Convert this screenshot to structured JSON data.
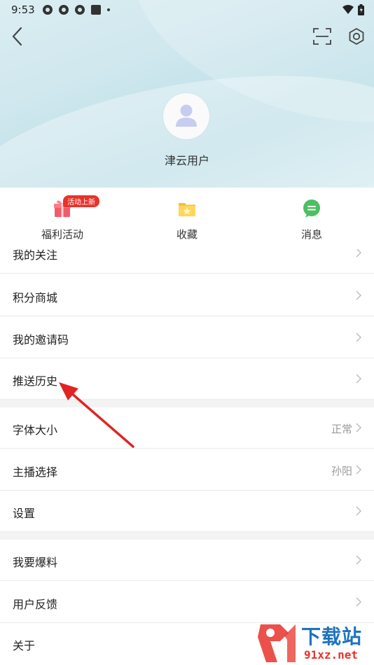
{
  "status_bar": {
    "time": "9:53"
  },
  "profile": {
    "username": "津云用户"
  },
  "quick_actions": [
    {
      "label": "福利活动",
      "badge": "活动上新",
      "icon": "gift-icon"
    },
    {
      "label": "收藏",
      "icon": "folder-star-icon"
    },
    {
      "label": "消息",
      "icon": "chat-bubble-icon"
    }
  ],
  "menu_group1": [
    {
      "label": "我的关注"
    },
    {
      "label": "积分商城"
    },
    {
      "label": "我的邀请码"
    },
    {
      "label": "推送历史"
    }
  ],
  "menu_group2": [
    {
      "label": "字体大小",
      "value": "正常"
    },
    {
      "label": "主播选择",
      "value": "孙阳"
    },
    {
      "label": "设置"
    }
  ],
  "menu_group3": [
    {
      "label": "我要爆料"
    },
    {
      "label": "用户反馈"
    },
    {
      "label": "关于"
    }
  ],
  "watermark": {
    "brand": "下载站",
    "domain": "91xz.net"
  },
  "colors": {
    "accent_red": "#e8332a",
    "brand_blue": "#1e73be",
    "header_bg": "#cfe7ee"
  }
}
